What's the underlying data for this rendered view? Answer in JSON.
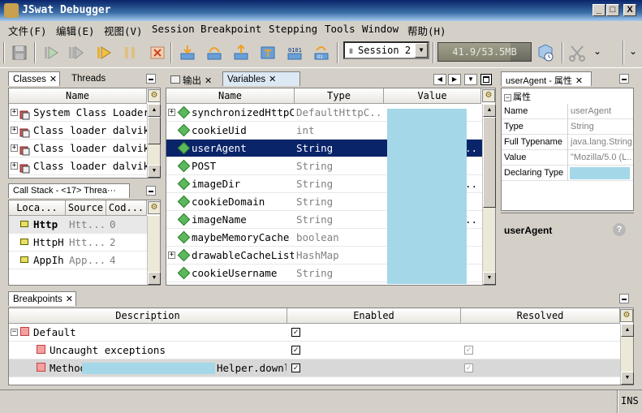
{
  "window": {
    "title": "JSwat Debugger",
    "minimize": "_",
    "maximize": "□",
    "close": "X"
  },
  "menu": [
    "文件(F)",
    "编辑(E)",
    "视图(V)",
    "Session",
    "Breakpoint",
    "Stepping",
    "Tools",
    "Window",
    "帮助(H)"
  ],
  "toolbar": {
    "session_combo": "Session 2",
    "memory": "41.9/53.5MB",
    "memory_used_fraction": 0.78
  },
  "classes_panel": {
    "tabs": [
      "Classes",
      "Threads"
    ],
    "header": "Name",
    "rows": [
      "System Class Loader",
      "Class loader dalvik.",
      "Class loader dalvik.",
      "Class loader dalvik."
    ]
  },
  "callstack_panel": {
    "tab": "Call Stack - <17> Threa···",
    "headers": [
      "Loca...",
      "Source",
      "Cod..."
    ],
    "rows": [
      {
        "location": "Http",
        "source": "Htt...",
        "code": "0",
        "bold": true
      },
      {
        "location": "HttpH",
        "source": "Htt...",
        "code": "2",
        "bold": false
      },
      {
        "location": "AppIh",
        "source": "App...",
        "code": "4",
        "bold": false
      }
    ]
  },
  "variables_panel": {
    "tabs": [
      "输出",
      "Variables"
    ],
    "headers": [
      "Name",
      "Type",
      "Value"
    ],
    "rows": [
      {
        "name": "synchronizedHttpCl",
        "type": "DefaultHttpC...",
        "value": "",
        "expandable": true,
        "selected": false
      },
      {
        "name": "cookieUid",
        "type": "int",
        "value": "",
        "expandable": false,
        "selected": false
      },
      {
        "name": "userAgent",
        "type": "String",
        "value": "..",
        "expandable": false,
        "selected": true
      },
      {
        "name": "POST",
        "type": "String",
        "value": "",
        "expandable": false,
        "selected": false
      },
      {
        "name": "imageDir",
        "type": "String",
        "value": "..",
        "expandable": false,
        "selected": false
      },
      {
        "name": "cookieDomain",
        "type": "String",
        "value": "",
        "expandable": false,
        "selected": false
      },
      {
        "name": "imageName",
        "type": "String",
        "value": "..",
        "expandable": false,
        "selected": false
      },
      {
        "name": "maybeMemoryCache",
        "type": "boolean",
        "value": "",
        "expandable": false,
        "selected": false
      },
      {
        "name": "drawableCacheList",
        "type": "HashMap",
        "value": "",
        "expandable": true,
        "selected": false
      },
      {
        "name": "cookieUsername",
        "type": "String",
        "value": "",
        "expandable": false,
        "selected": false
      }
    ]
  },
  "properties_panel": {
    "tab": "userAgent - 属性",
    "group": "属性",
    "rows": [
      {
        "label": "Name",
        "value": "userAgent"
      },
      {
        "label": "Type",
        "value": "String"
      },
      {
        "label": "Full Typename",
        "value": "java.lang.String"
      },
      {
        "label": "Value",
        "value": "\"Mozilla/5.0 (L..."
      },
      {
        "label": "Declaring Type",
        "value": ""
      }
    ],
    "description_title": "userAgent"
  },
  "breakpoints_panel": {
    "tab": "Breakpoints",
    "headers": [
      "Description",
      "Enabled",
      "Resolved"
    ],
    "rows": [
      {
        "description": "Default",
        "enabled": true,
        "resolved": null,
        "level": 0
      },
      {
        "description": "Uncaught exceptions",
        "enabled": true,
        "resolved": true,
        "level": 1
      },
      {
        "description": "Method",
        "description_tail": "Helper.downl",
        "enabled": true,
        "resolved": true,
        "level": 1
      }
    ]
  },
  "status": {
    "mode": "INS"
  }
}
